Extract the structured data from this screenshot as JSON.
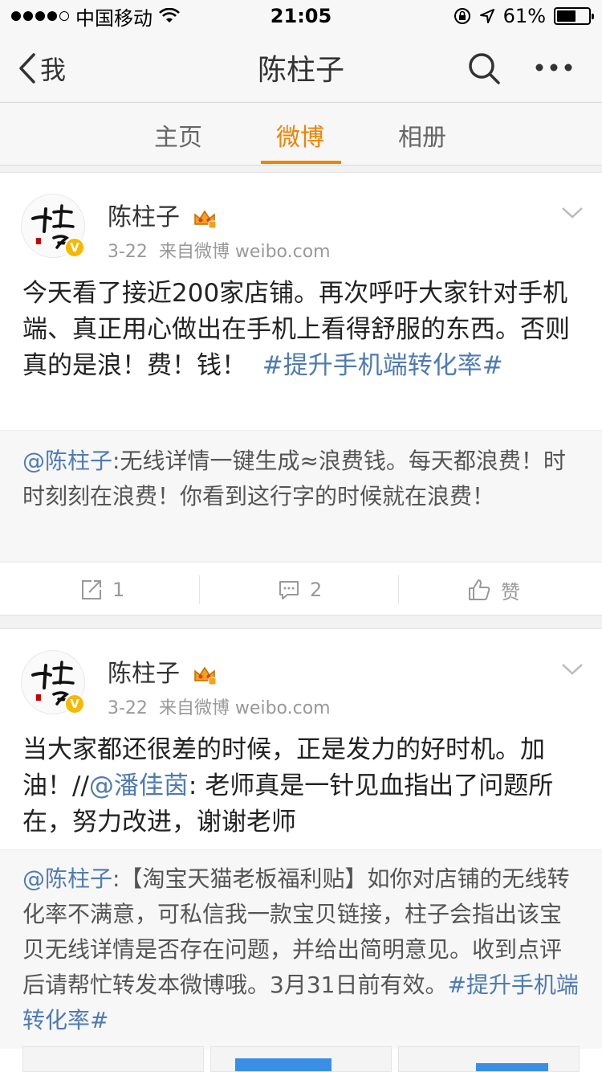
{
  "status_bar": {
    "carrier": "中国移动",
    "time": "21:05",
    "battery": "61%",
    "battery_level": 0.61
  },
  "nav": {
    "back_label": "我",
    "title": "陈柱子"
  },
  "tabs": [
    {
      "label": "主页",
      "active": false
    },
    {
      "label": "微博",
      "active": true
    },
    {
      "label": "相册",
      "active": false
    }
  ],
  "posts": [
    {
      "author": "陈柱子",
      "date": "3-22",
      "source": "来自微博 weibo.com",
      "text": "今天看了接近200家店铺。再次呼吁大家针对手机端、真正用心做出在手机上看得舒服的东西。否则真的是浪！费！钱！",
      "topic": "#提升手机端转化率#",
      "repost_mention": "@陈柱子",
      "repost_text": ":无线详情一键生成≈浪费钱。每天都浪费！时时刻刻在浪费！你看到这行字的时候就在浪费！",
      "share_count": "1",
      "comment_count": "2",
      "like_label": "赞"
    },
    {
      "author": "陈柱子",
      "date": "3-22",
      "source": "来自微博 weibo.com",
      "text_before": "当大家都还很差的时候，正是发力的好时机。加油！//",
      "mention": "@潘佳茵",
      "text_after": ": 老师真是一针见血指出了问题所在，努力改进，谢谢老师",
      "repost_mention": "@陈柱子",
      "repost_text": ":【淘宝天猫老板福利贴】如你对店铺的无线转化率不满意，可私信我一款宝贝链接，柱子会指出该宝贝无线详情是否存在问题，并给出简明意见。收到点评后请帮忙转发本微博哦。3月31日前有效。",
      "repost_topic": "#提升手机端转化率#"
    }
  ],
  "colors": {
    "accent": "#f08300",
    "link": "#4f7bb3",
    "verified": "#f6b800"
  },
  "icons": [
    "back-chevron-icon",
    "search-icon",
    "more-icon",
    "crown-icon",
    "verified-icon",
    "chevron-down-icon",
    "share-icon",
    "comment-icon",
    "like-icon"
  ]
}
